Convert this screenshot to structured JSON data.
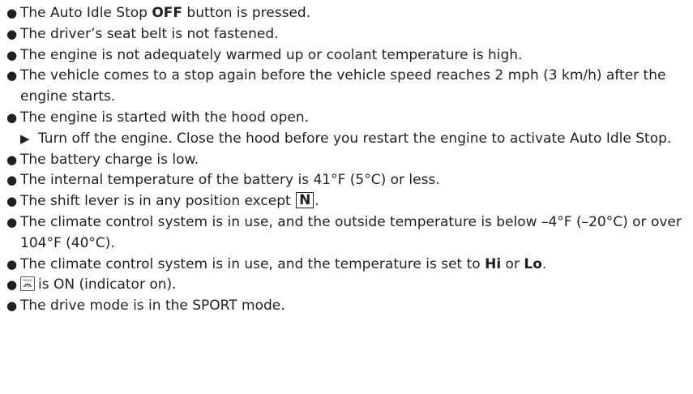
{
  "list": {
    "item0": {
      "pre": "The Auto Idle Stop ",
      "bold": "OFF",
      "post": " button is pressed."
    },
    "item1": "The driver’s seat belt is not fastened.",
    "item2": "The engine is not adequately warmed up or coolant temperature is high.",
    "item3": "The vehicle comes to a stop again before the vehicle speed reaches 2 mph (3 km/h) after the engine starts.",
    "item4": {
      "text": "The engine is started with the hood open.",
      "sub": "Turn off the engine. Close the hood before you restart the engine to activate Auto Idle Stop."
    },
    "item5": "The battery charge is low.",
    "item6": "The internal temperature of the battery is 41°F (5°C) or less.",
    "item7": {
      "pre": "The shift lever is in any position except ",
      "boxed": "N",
      "post": "."
    },
    "item8": "The climate control system is in use, and the outside temperature is below –4°F (–20°C) or over 104°F (40°C).",
    "item9": {
      "pre": "The climate control system is in use, and the temperature is set to ",
      "bold1": "Hi",
      "mid": " or ",
      "bold2": "Lo",
      "post": "."
    },
    "item10": {
      "icon_text": "FRONT",
      "text": "is ON (indicator on)."
    },
    "item11": "The drive mode is in the SPORT mode."
  },
  "icons": {
    "bullet": "bullet-icon",
    "arrow": "right-triangle-icon",
    "defrost": "front-defroster-icon"
  }
}
